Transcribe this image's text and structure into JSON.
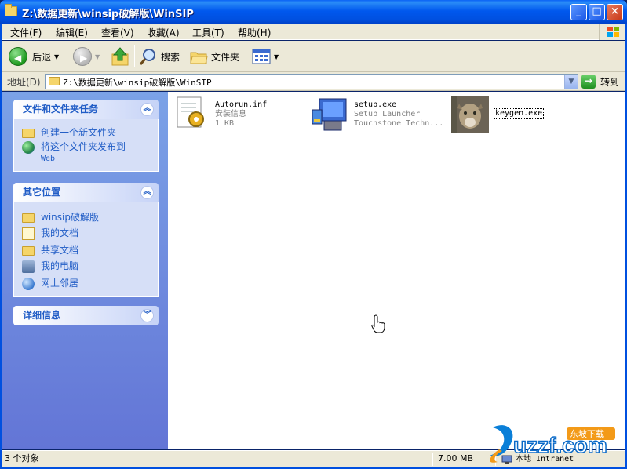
{
  "window": {
    "title": "Z:\\数据更新\\winsip破解版\\WinSIP",
    "minimize_label": "_",
    "maximize_label": "□",
    "close_label": "×"
  },
  "menu": [
    "文件(F)",
    "编辑(E)",
    "查看(V)",
    "收藏(A)",
    "工具(T)",
    "帮助(H)"
  ],
  "toolbar": {
    "back_label": "后退",
    "search_label": "搜索",
    "folders_label": "文件夹"
  },
  "address": {
    "label": "地址(D)",
    "value": "Z:\\数据更新\\winsip破解版\\WinSIP",
    "go_label": "转到"
  },
  "panels": {
    "tasks": {
      "title": "文件和文件夹任务",
      "items": [
        "创建一个新文件夹",
        "将这个文件夹发布到",
        "Web"
      ]
    },
    "places": {
      "title": "其它位置",
      "items": [
        "winsip破解版",
        "我的文档",
        "共享文档",
        "我的电脑",
        "网上邻居"
      ]
    },
    "details": {
      "title": "详细信息"
    }
  },
  "files": [
    {
      "name": "Autorun.inf",
      "line2": "安装信息",
      "line3": "1 KB",
      "icon": "settings-file-icon"
    },
    {
      "name": "setup.exe",
      "line2": "Setup Launcher",
      "line3": "Touchstone Techn...",
      "icon": "installer-icon"
    },
    {
      "name": "keygen.exe",
      "line2": "",
      "line3": "",
      "icon": "cougar-image-icon"
    }
  ],
  "status": {
    "objects": "3 个对象",
    "size": "7.00 MB",
    "zone": "本地 Intranet"
  },
  "watermark": {
    "brand": "uzzf.com",
    "tag": "东坡下载"
  }
}
